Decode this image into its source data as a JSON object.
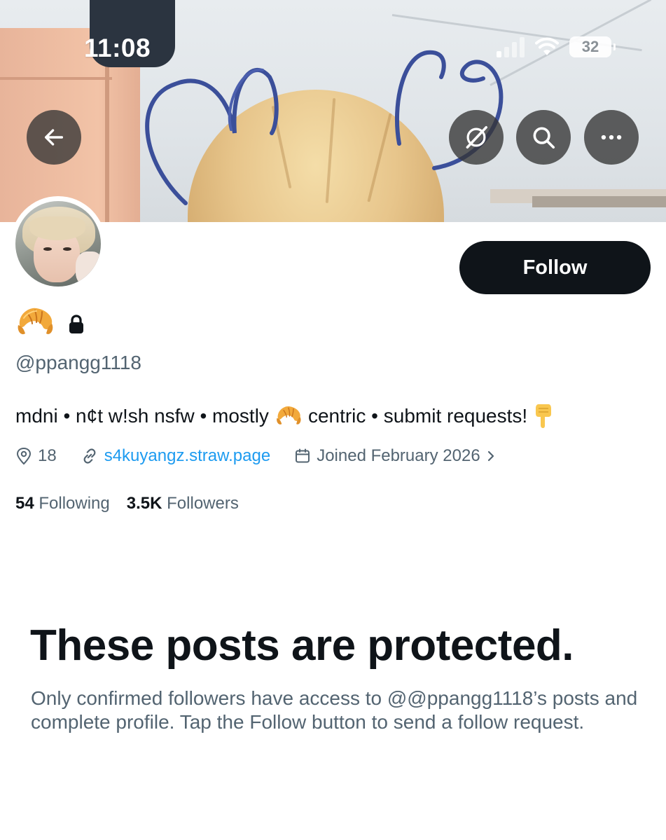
{
  "status_bar": {
    "time": "11:08",
    "battery": "32",
    "signal_bars_on": 1,
    "signal_bars_total": 4
  },
  "banner": {
    "back_icon": "arrow-left-icon",
    "grok_icon": "grok-slash-icon",
    "search_icon": "search-icon",
    "more_icon": "more-horizontal-icon"
  },
  "profile": {
    "display_name_emoji": "croissant-emoji",
    "protected_icon": "lock-icon",
    "handle": "@ppangg1118",
    "follow_label": "Follow",
    "bio": {
      "part1": "mdni • n¢t w!sh nsfw • mostly",
      "emoji1": "croissant-emoji",
      "part2": "centric • submit requests!",
      "emoji2": "pointing-down-emoji"
    },
    "meta": {
      "location": "18",
      "website": "s4kuyangz.straw.page",
      "joined": "Joined February 2026"
    },
    "stats": {
      "following_count": "54",
      "following_label": "Following",
      "followers_count": "3.5K",
      "followers_label": "Followers"
    }
  },
  "protected": {
    "title": "These posts are protected.",
    "body": "Only confirmed followers have access to @@ppangg1118’s posts and complete profile. Tap the Follow button to send a follow request."
  },
  "colors": {
    "text_primary": "#0f1419",
    "text_secondary": "#536471",
    "link": "#1d9bf0",
    "follow_bg": "#0f1419"
  }
}
